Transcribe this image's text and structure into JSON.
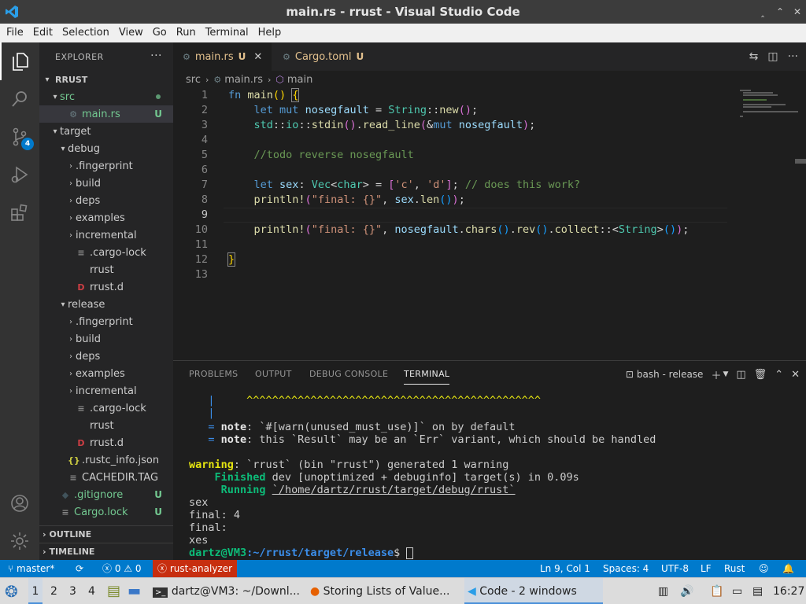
{
  "window": {
    "title": "main.rs - rrust - Visual Studio Code",
    "controls": [
      "‸",
      "⌃",
      "✕"
    ]
  },
  "menu": [
    "File",
    "Edit",
    "Selection",
    "View",
    "Go",
    "Run",
    "Terminal",
    "Help"
  ],
  "activity": {
    "scm_badge": "4"
  },
  "explorer": {
    "header": "EXPLORER",
    "more": "···",
    "root": "RRUST",
    "items": [
      {
        "label": "src",
        "git": "",
        "kind": "folder-open",
        "color": "#73c991"
      },
      {
        "label": "main.rs",
        "git": "U",
        "kind": "rust",
        "color": "#73c991"
      },
      {
        "label": "target",
        "git": "",
        "kind": "folder-open",
        "color": "#cccccc"
      },
      {
        "label": "debug",
        "git": "",
        "kind": "folder-open",
        "color": "#cccccc"
      },
      {
        "label": ".fingerprint",
        "git": "",
        "kind": "folder",
        "color": "#cccccc"
      },
      {
        "label": "build",
        "git": "",
        "kind": "folder",
        "color": "#cccccc"
      },
      {
        "label": "deps",
        "git": "",
        "kind": "folder",
        "color": "#cccccc"
      },
      {
        "label": "examples",
        "git": "",
        "kind": "folder",
        "color": "#cccccc"
      },
      {
        "label": "incremental",
        "git": "",
        "kind": "folder",
        "color": "#cccccc"
      },
      {
        "label": ".cargo-lock",
        "git": "",
        "kind": "lines",
        "color": "#cccccc"
      },
      {
        "label": "rrust",
        "git": "",
        "kind": "blank",
        "color": "#cccccc"
      },
      {
        "label": "rrust.d",
        "git": "",
        "kind": "d",
        "color": "#cccccc"
      },
      {
        "label": "release",
        "git": "",
        "kind": "folder-open",
        "color": "#cccccc"
      },
      {
        "label": ".fingerprint",
        "git": "",
        "kind": "folder",
        "color": "#cccccc"
      },
      {
        "label": "build",
        "git": "",
        "kind": "folder",
        "color": "#cccccc"
      },
      {
        "label": "deps",
        "git": "",
        "kind": "folder",
        "color": "#cccccc"
      },
      {
        "label": "examples",
        "git": "",
        "kind": "folder",
        "color": "#cccccc"
      },
      {
        "label": "incremental",
        "git": "",
        "kind": "folder",
        "color": "#cccccc"
      },
      {
        "label": ".cargo-lock",
        "git": "",
        "kind": "lines",
        "color": "#cccccc"
      },
      {
        "label": "rrust",
        "git": "",
        "kind": "blank",
        "color": "#cccccc"
      },
      {
        "label": "rrust.d",
        "git": "",
        "kind": "d",
        "color": "#cccccc"
      },
      {
        "label": ".rustc_info.json",
        "git": "",
        "kind": "json",
        "color": "#cccccc"
      },
      {
        "label": "CACHEDIR.TAG",
        "git": "",
        "kind": "lines",
        "color": "#cccccc"
      },
      {
        "label": ".gitignore",
        "git": "U",
        "kind": "git",
        "color": "#73c991"
      },
      {
        "label": "Cargo.lock",
        "git": "U",
        "kind": "lines",
        "color": "#73c991"
      }
    ],
    "outline": "OUTLINE",
    "timeline": "TIMELINE"
  },
  "tabs": [
    {
      "label": "main.rs",
      "mod": "U",
      "close": "✕"
    },
    {
      "label": "Cargo.toml",
      "mod": "U"
    }
  ],
  "breadcrumb": {
    "folder": "src",
    "file": "main.rs",
    "symbol": "main"
  },
  "editor": {
    "line_numbers": [
      "1",
      "2",
      "3",
      "4",
      "5",
      "6",
      "7",
      "8",
      "9",
      "10",
      "11",
      "12",
      "13"
    ],
    "current_line": 9
  },
  "panel": {
    "tabs": [
      "PROBLEMS",
      "OUTPUT",
      "DEBUG CONSOLE",
      "TERMINAL"
    ],
    "terminal_name": "bash - release",
    "terminal": {
      "carets": "^^^^^^^^^^^^^^^^^^^^^^^^^^^^^^^^^^^^^^^^^^^^^^",
      "note1_label": "note",
      "note1_text": ": `#[warn(unused_must_use)]` on by default",
      "note2_label": "note",
      "note2_text": ": this `Result` may be an `Err` variant, which should be handled",
      "warning_label": "warning",
      "warning_text": ": `rrust` (bin \"rrust\") generated 1 warning",
      "finished_label": "Finished",
      "finished_text": " dev [unoptimized + debuginfo] target(s) in 0.09s",
      "running_label": "Running",
      "running_path": "`/home/dartz/rrust/target/debug/rrust`",
      "out1": "sex",
      "out2": "final: 4",
      "out3": "final:",
      "out4": "xes",
      "prompt_user": "dartz@VM3",
      "prompt_path": ":~/rrust/target/release",
      "prompt_sym": "$ "
    }
  },
  "status": {
    "branch": "master*",
    "errors": "0",
    "warnings": "0",
    "analyzer": "rust-analyzer",
    "position": "Ln 9, Col 1",
    "spaces": "Spaces: 4",
    "encoding": "UTF-8",
    "eol": "LF",
    "language": "Rust"
  },
  "taskbar": {
    "workspaces": [
      "1",
      "2",
      "3",
      "4"
    ],
    "tasks": [
      {
        "label": "dartz@VM3: ~/Downl..."
      },
      {
        "label": "Storing Lists of Value..."
      },
      {
        "label": "Code - 2 windows"
      }
    ],
    "clock": "16:27"
  },
  "colors": {
    "accent": "#007acc",
    "analyzer_error": "#c72e0f",
    "git_untracked": "#73c991",
    "modified": "#e2c08d"
  }
}
